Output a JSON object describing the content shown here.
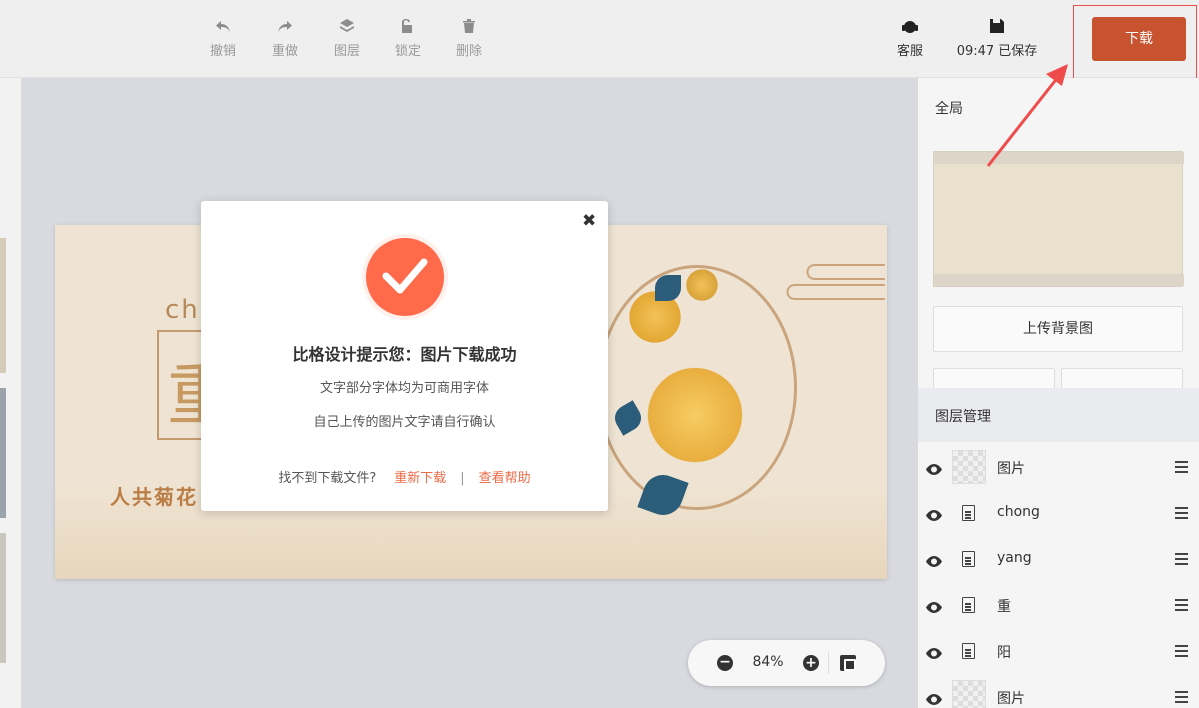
{
  "toolbar": {
    "undo_label": "撤销",
    "redo_label": "重做",
    "layers_label": "图层",
    "lock_label": "锁定",
    "delete_label": "删除",
    "service_label": "客服",
    "saved_label": "09:47 已保存",
    "download_label": "下载"
  },
  "canvas": {
    "design": {
      "pinyin": "chong",
      "big_char": "重",
      "phrase": "人共菊花"
    },
    "zoom_value": "84%"
  },
  "right_panel": {
    "global_title": "全局",
    "upload_bg_label": "上传背景图",
    "layers_title": "图层管理",
    "layers": [
      {
        "name": "图片",
        "kind": "image"
      },
      {
        "name": "chong",
        "kind": "text"
      },
      {
        "name": "yang",
        "kind": "text"
      },
      {
        "name": "重",
        "kind": "text"
      },
      {
        "name": "阳",
        "kind": "text"
      },
      {
        "name": "图片",
        "kind": "image"
      }
    ]
  },
  "modal": {
    "close_glyph": "✖",
    "title": "比格设计提示您：图片下载成功",
    "line1": "文字部分字体均为可商用字体",
    "line2": "自己上传的图片文字请自行确认",
    "not_found": "找不到下载文件?",
    "redownload": "重新下载",
    "separator": "|",
    "help": "查看帮助"
  },
  "colors": {
    "accent": "#c7542f",
    "success": "#ff6b4a",
    "link": "#ec6a46",
    "annotation": "#f04b4b"
  },
  "icons": [
    "undo-icon",
    "redo-icon",
    "layers-icon",
    "unlock-icon",
    "trash-icon",
    "service-icon",
    "save-icon",
    "eye-icon",
    "drag-handle-icon",
    "document-icon",
    "check-icon",
    "close-icon",
    "zoom-out-icon",
    "zoom-in-icon",
    "fit-screen-icon"
  ]
}
